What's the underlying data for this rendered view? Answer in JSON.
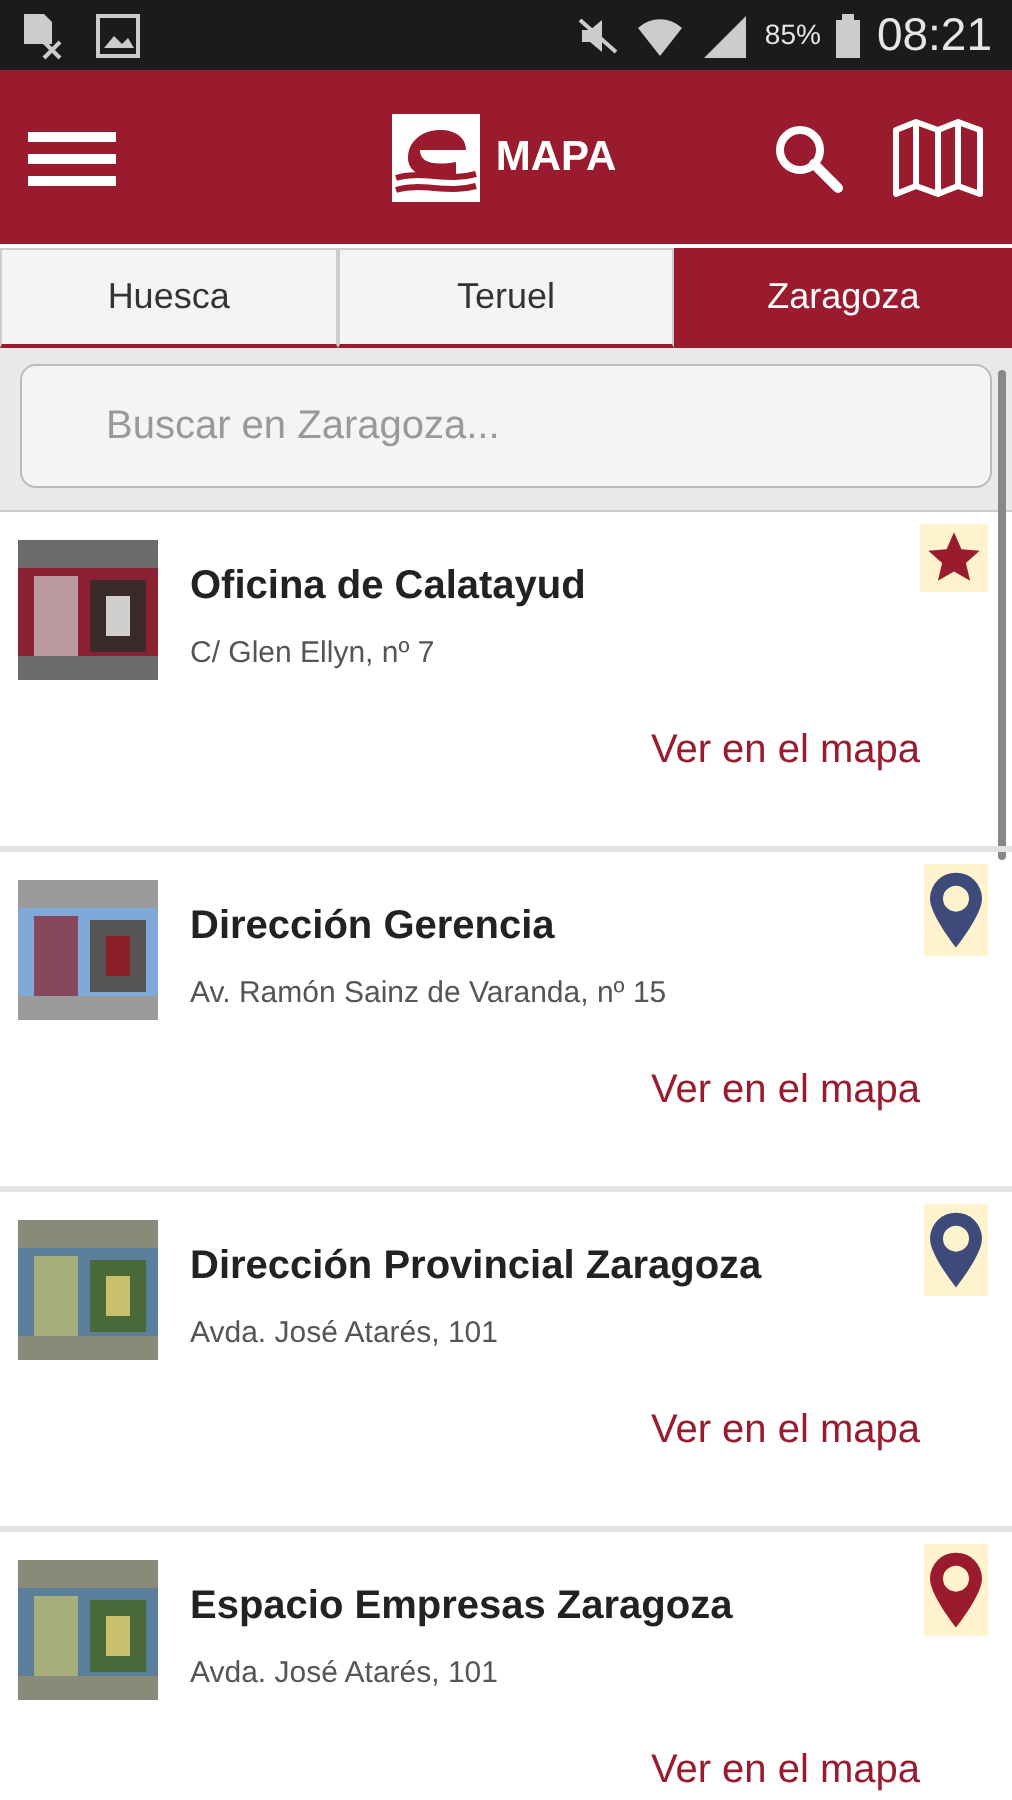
{
  "status_bar": {
    "battery": "85%",
    "time": "08:21"
  },
  "app_bar": {
    "title": "MAPA"
  },
  "tabs": [
    {
      "label": "Huesca",
      "selected": false
    },
    {
      "label": "Teruel",
      "selected": false
    },
    {
      "label": "Zaragoza",
      "selected": true
    }
  ],
  "search": {
    "placeholder": "Buscar en Zaragoza..."
  },
  "places": [
    {
      "name": "Oficina de Calatayud",
      "address": "C/ Glen Ellyn, nº 7",
      "link": "Ver en el mapa",
      "marker": {
        "kind": "star",
        "color": "#9b1b2e"
      }
    },
    {
      "name": "Dirección Gerencia",
      "address": "Av. Ramón Sainz de Varanda, nº 15",
      "link": "Ver en el mapa",
      "marker": {
        "kind": "pin",
        "color": "#3d4a7a"
      }
    },
    {
      "name": "Dirección Provincial Zaragoza",
      "address": "Avda. José Atarés, 101",
      "link": "Ver en el mapa",
      "marker": {
        "kind": "pin",
        "color": "#3d4a7a"
      }
    },
    {
      "name": "Espacio Empresas Zaragoza",
      "address": "Avda. José Atarés, 101",
      "link": "Ver en el mapa",
      "marker": {
        "kind": "pin",
        "color": "#9b1b2e"
      }
    }
  ]
}
